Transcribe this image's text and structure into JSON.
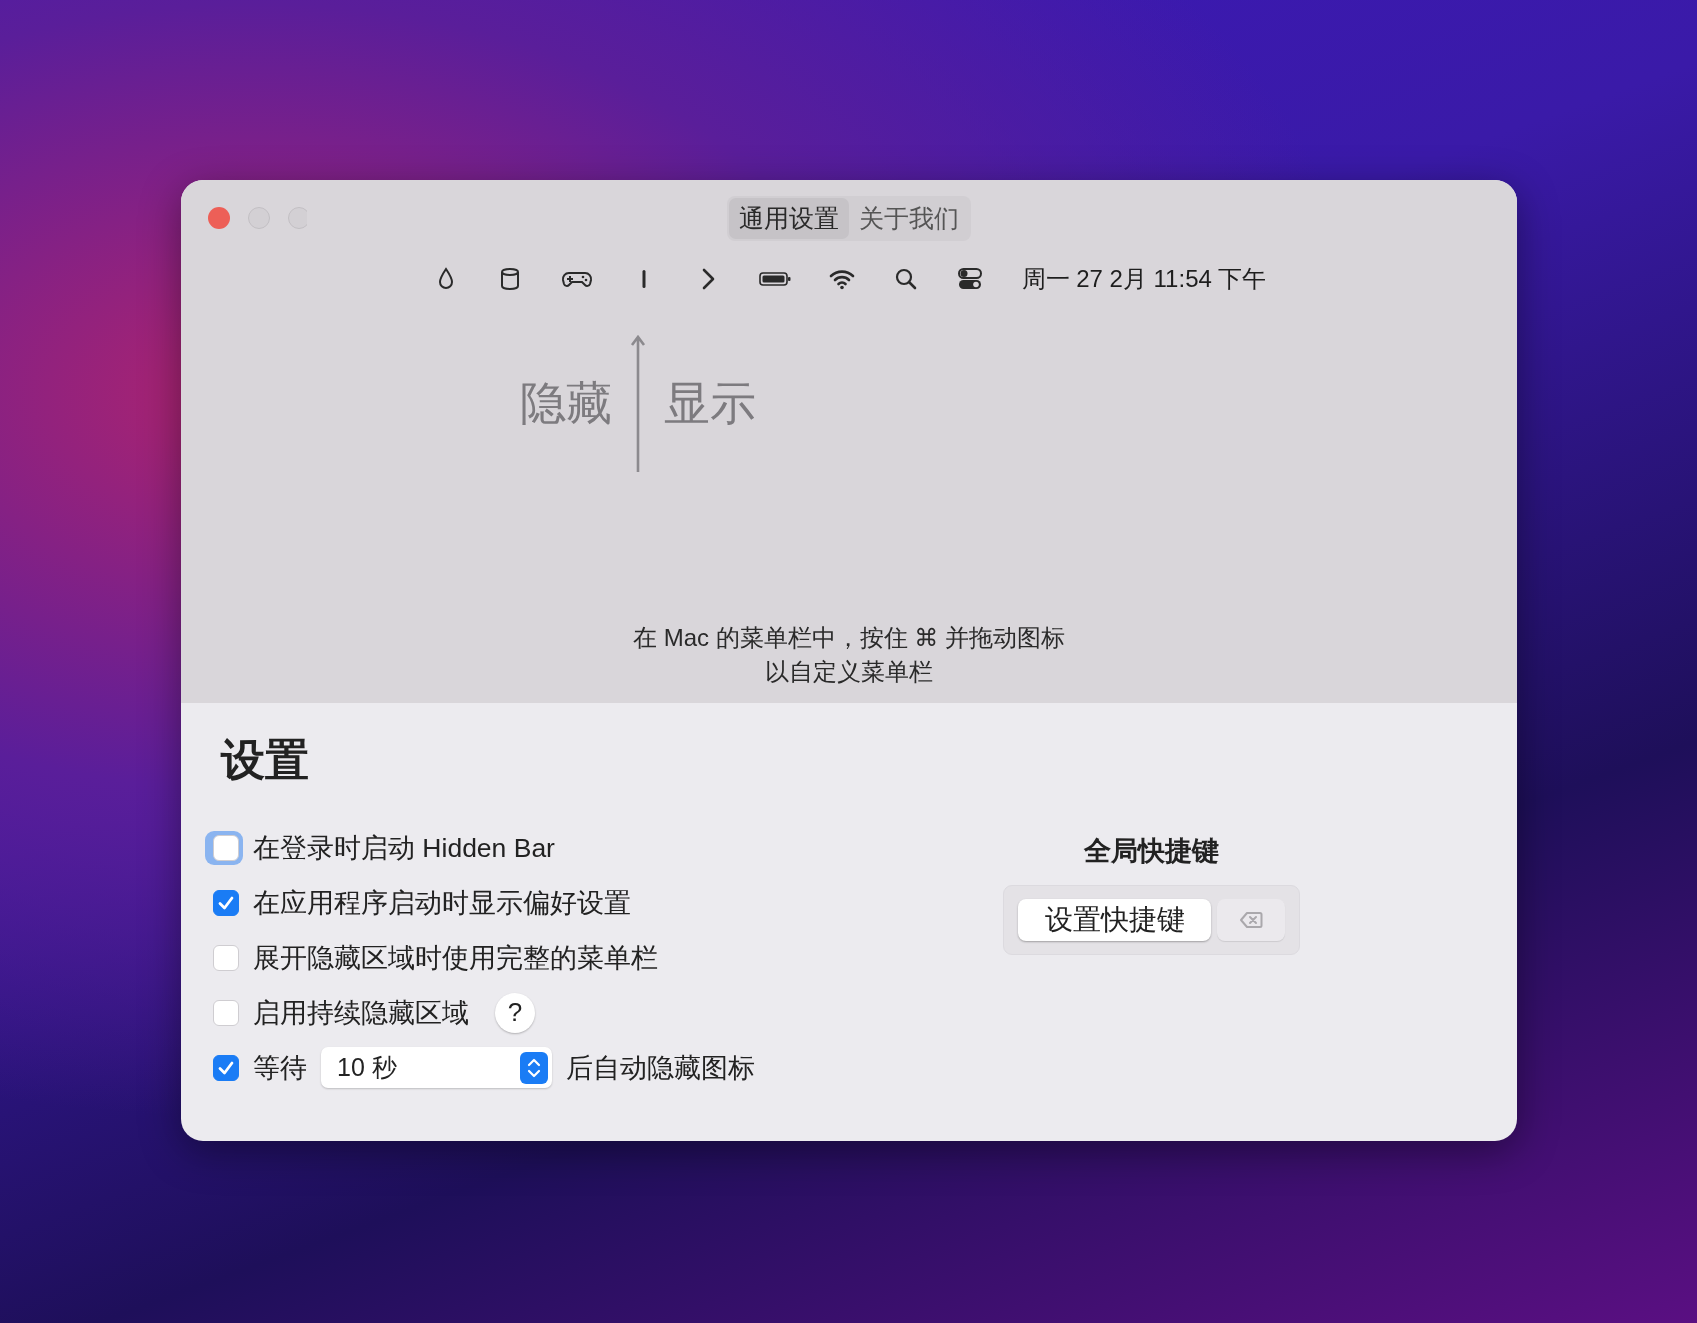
{
  "window": {
    "tabs": [
      {
        "label": "通用设置",
        "selected": true
      },
      {
        "label": "关于我们",
        "selected": false
      }
    ]
  },
  "menubar_preview": {
    "clock": "周一 27 2月 11:54 下午"
  },
  "diagram": {
    "hide_label": "隐藏",
    "show_label": "显示"
  },
  "instructions": [
    "在 Mac 的菜单栏中，按住 ⌘ 并拖动图标",
    "以自定义菜单栏"
  ],
  "settings": {
    "title": "设置",
    "options": [
      {
        "kind": "checkbox",
        "label": "在登录时启动 Hidden Bar",
        "checked": false,
        "focused": true
      },
      {
        "kind": "checkbox",
        "label": "在应用程序启动时显示偏好设置",
        "checked": true,
        "focused": false
      },
      {
        "kind": "checkbox",
        "label": "展开隐藏区域时使用完整的菜单栏",
        "checked": false,
        "focused": false
      },
      {
        "kind": "help",
        "label": "启用持续隐藏区域",
        "checked": false,
        "focused": false,
        "help": "?"
      },
      {
        "kind": "delay",
        "label": "等待",
        "checked": true,
        "focused": false,
        "select_value": "10 秒",
        "suffix": "后自动隐藏图标"
      }
    ]
  },
  "shortcut": {
    "title": "全局快捷键",
    "button": "设置快捷键"
  }
}
